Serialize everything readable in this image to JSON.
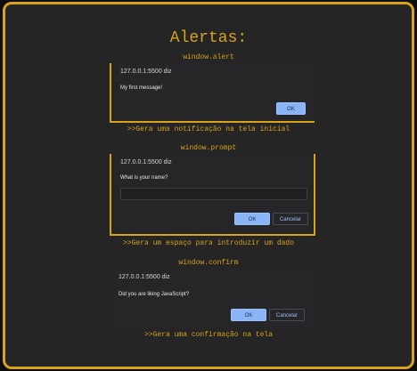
{
  "page": {
    "title": "Alertas:"
  },
  "sections": [
    {
      "label": "window.alert",
      "dialog": {
        "origin": "127.0.0.1:5500 diz",
        "message": "My first message!",
        "ok_label": "OK"
      },
      "caption": ">>Gera uma notificação na tela inicial"
    },
    {
      "label": "window.prompt",
      "dialog": {
        "origin": "127.0.0.1:5500 diz",
        "message": "What is your name?",
        "input_value": "",
        "ok_label": "OK",
        "cancel_label": "Cancelar"
      },
      "caption": ">>Gera um espaço para introduzir um dado"
    },
    {
      "label": "window.confirm",
      "dialog": {
        "origin": "127.0.0.1:5500 diz",
        "message": "Did you are liking JavaScript?",
        "ok_label": "OK",
        "cancel_label": "Cancelar"
      },
      "caption": ">>Gera uma confirmação na tela"
    }
  ],
  "colors": {
    "accent": "#d9a21b",
    "background": "#252525",
    "dialog": "#262629",
    "button_primary": "#8ab4f8"
  }
}
